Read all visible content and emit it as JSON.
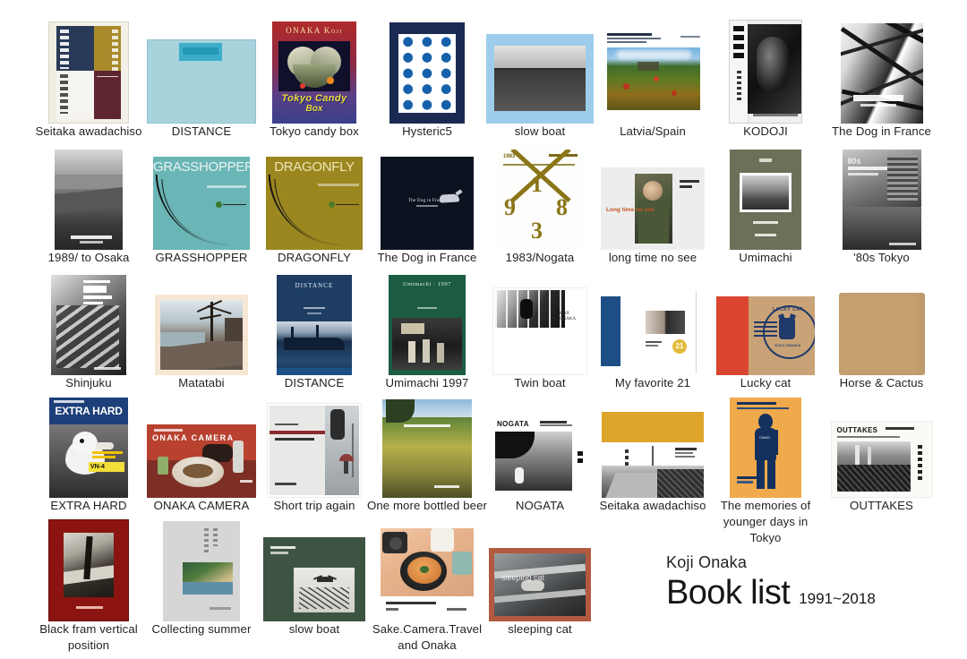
{
  "title_block": {
    "author": "Koji Onaka",
    "heading": "Book list",
    "years": "1991~2018"
  },
  "covers": {
    "tokyo_candy_box": {
      "artist": "ONAKA Kōji",
      "line1": "Tokyo Candy",
      "line2": "Box"
    },
    "grasshopper": {
      "title": "GRASSHOPPER"
    },
    "dragonfly": {
      "title": "DRAGONFLY"
    },
    "nogata_1983": {
      "year": "1983",
      "digits": [
        "1",
        "9",
        "8",
        "3"
      ]
    },
    "long_time_no_see": {
      "title": "Long time no see"
    },
    "distance_2000": {
      "title": "DISTANCE"
    },
    "umimachi_1997": {
      "title": "Umimachi · 1997"
    },
    "dog_in_france_black": {
      "title": "The Dog in France"
    },
    "extra_hard": {
      "title": "EXTRA HARD",
      "code": "VN-4"
    },
    "onaka_camera": {
      "title": "ONAKA CAMERA"
    },
    "nogata": {
      "title": "NOGATA"
    },
    "outtakes": {
      "title": "OUTTAKES"
    },
    "lucky_cat": {
      "top_text": "LUCKY CAT",
      "bottom_text": "KOJI ONAKA"
    },
    "my_favorite_21": {
      "badge": "21"
    },
    "twin_boat": {
      "credit": "KOJI ONAKA"
    },
    "eighties_tokyo": {
      "title": "80s"
    }
  },
  "grid": {
    "rows": [
      {
        "items": [
          {
            "caption": "Seitaka awadachiso"
          },
          {
            "caption": "DISTANCE"
          },
          {
            "caption": "Tokyo candy box"
          },
          {
            "caption": "Hysteric5"
          },
          {
            "caption": "slow boat"
          },
          {
            "caption": "Latvia/Spain"
          },
          {
            "caption": "KODOJI"
          },
          {
            "caption": "The Dog in France"
          }
        ]
      },
      {
        "items": [
          {
            "caption": "1989/ to Osaka"
          },
          {
            "caption": "GRASSHOPPER"
          },
          {
            "caption": "DRAGONFLY"
          },
          {
            "caption": "The Dog in France"
          },
          {
            "caption": "1983/Nogata"
          },
          {
            "caption": "long time no see"
          },
          {
            "caption": "Umimachi"
          },
          {
            "caption": "'80s Tokyo"
          }
        ]
      },
      {
        "items": [
          {
            "caption": "Shinjuku"
          },
          {
            "caption": "Matatabi"
          },
          {
            "caption": "DISTANCE"
          },
          {
            "caption": "Umimachi 1997"
          },
          {
            "caption": "Twin boat"
          },
          {
            "caption": "My favorite 21"
          },
          {
            "caption": "Lucky cat"
          },
          {
            "caption": "Horse & Cactus"
          }
        ]
      },
      {
        "items": [
          {
            "caption": "EXTRA HARD"
          },
          {
            "caption": "ONAKA CAMERA"
          },
          {
            "caption": "Short trip again"
          },
          {
            "caption": "One more bottled beer"
          },
          {
            "caption": "NOGATA"
          },
          {
            "caption": "Seitaka awadachiso"
          },
          {
            "caption": "The memories of younger days in Tokyo"
          },
          {
            "caption": "OUTTAKES"
          }
        ]
      },
      {
        "items": [
          {
            "caption": "Black fram vertical position"
          },
          {
            "caption": "Collecting summer"
          },
          {
            "caption": "slow boat"
          },
          {
            "caption": "Sake.Camera.Travel and Onaka"
          },
          {
            "caption": "sleeping cat"
          }
        ]
      }
    ]
  }
}
